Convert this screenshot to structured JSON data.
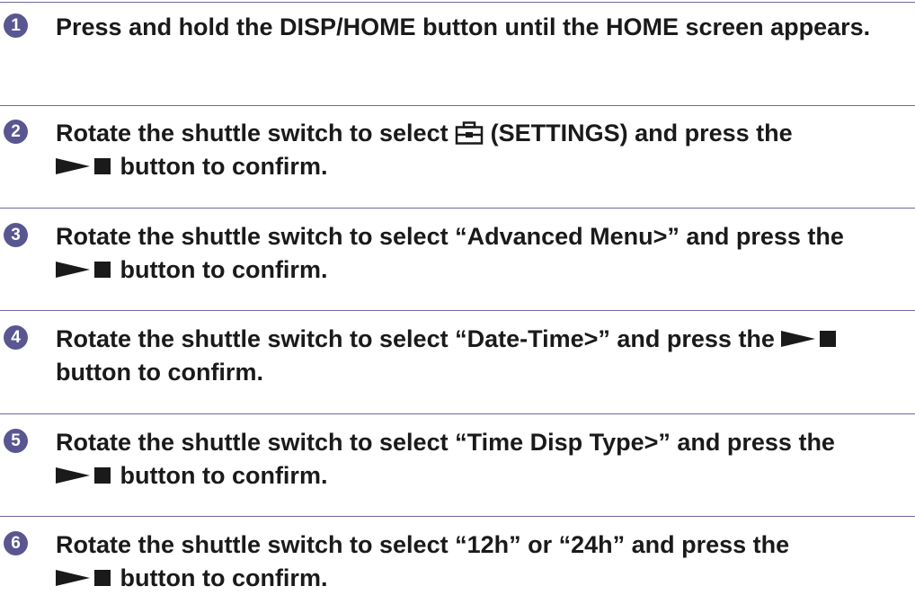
{
  "steps": [
    {
      "number": "1",
      "text_a": "Press and hold the DISP/HOME button until the HOME screen appears."
    },
    {
      "number": "2",
      "text_a": "Rotate the shuttle switch to select ",
      "icon": "settings-toolbox-icon",
      "text_b": " (SETTINGS) and press the",
      "button_icon": "play-stop-icon",
      "text_c": " button to confirm."
    },
    {
      "number": "3",
      "text_a": "Rotate the shuttle switch to select “Advanced Menu>” and press the",
      "button_icon": "play-stop-icon",
      "text_c": " button to confirm."
    },
    {
      "number": "4",
      "text_a": "Rotate the shuttle switch to select “Date-Time>” and press the ",
      "button_icon": "play-stop-icon",
      "text_c": "button to confirm."
    },
    {
      "number": "5",
      "text_a": "Rotate the shuttle switch to select “Time Disp Type>” and press the",
      "button_icon": "play-stop-icon",
      "text_c": " button to confirm."
    },
    {
      "number": "6",
      "text_a": "Rotate the shuttle switch to select “12h” or “24h” and press the",
      "button_icon": "play-stop-icon",
      "text_c": " button to confirm."
    }
  ],
  "colors": {
    "accent": "#5a5691",
    "rule": "#6d6a9e",
    "text": "#1a1a1a"
  }
}
